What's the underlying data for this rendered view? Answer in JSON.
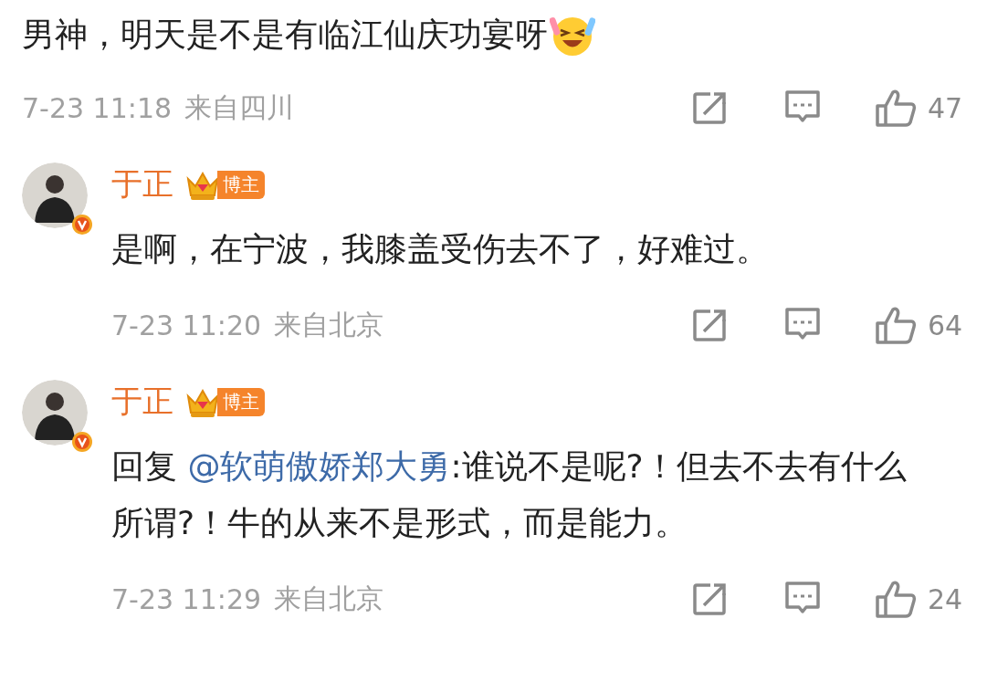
{
  "post": {
    "text": "男神，明天是不是有临江仙庆功宴呀",
    "time": "7-23 11:18",
    "location": "来自四川",
    "likes": "47"
  },
  "replies": [
    {
      "author": "于正",
      "badge": "博主",
      "verified": true,
      "text": "是啊，在宁波，我膝盖受伤去不了，好难过。",
      "time": "7-23 11:20",
      "location": "来自北京",
      "likes": "64"
    },
    {
      "author": "于正",
      "badge": "博主",
      "verified": true,
      "prefix": "回复 ",
      "mention": "@软萌傲娇郑大勇",
      "text": ":谁说不是呢?！但去不去有什么所谓?！牛的从来不是形式，而是能力。",
      "time": "7-23 11:29",
      "location": "来自北京",
      "likes": "24"
    }
  ]
}
